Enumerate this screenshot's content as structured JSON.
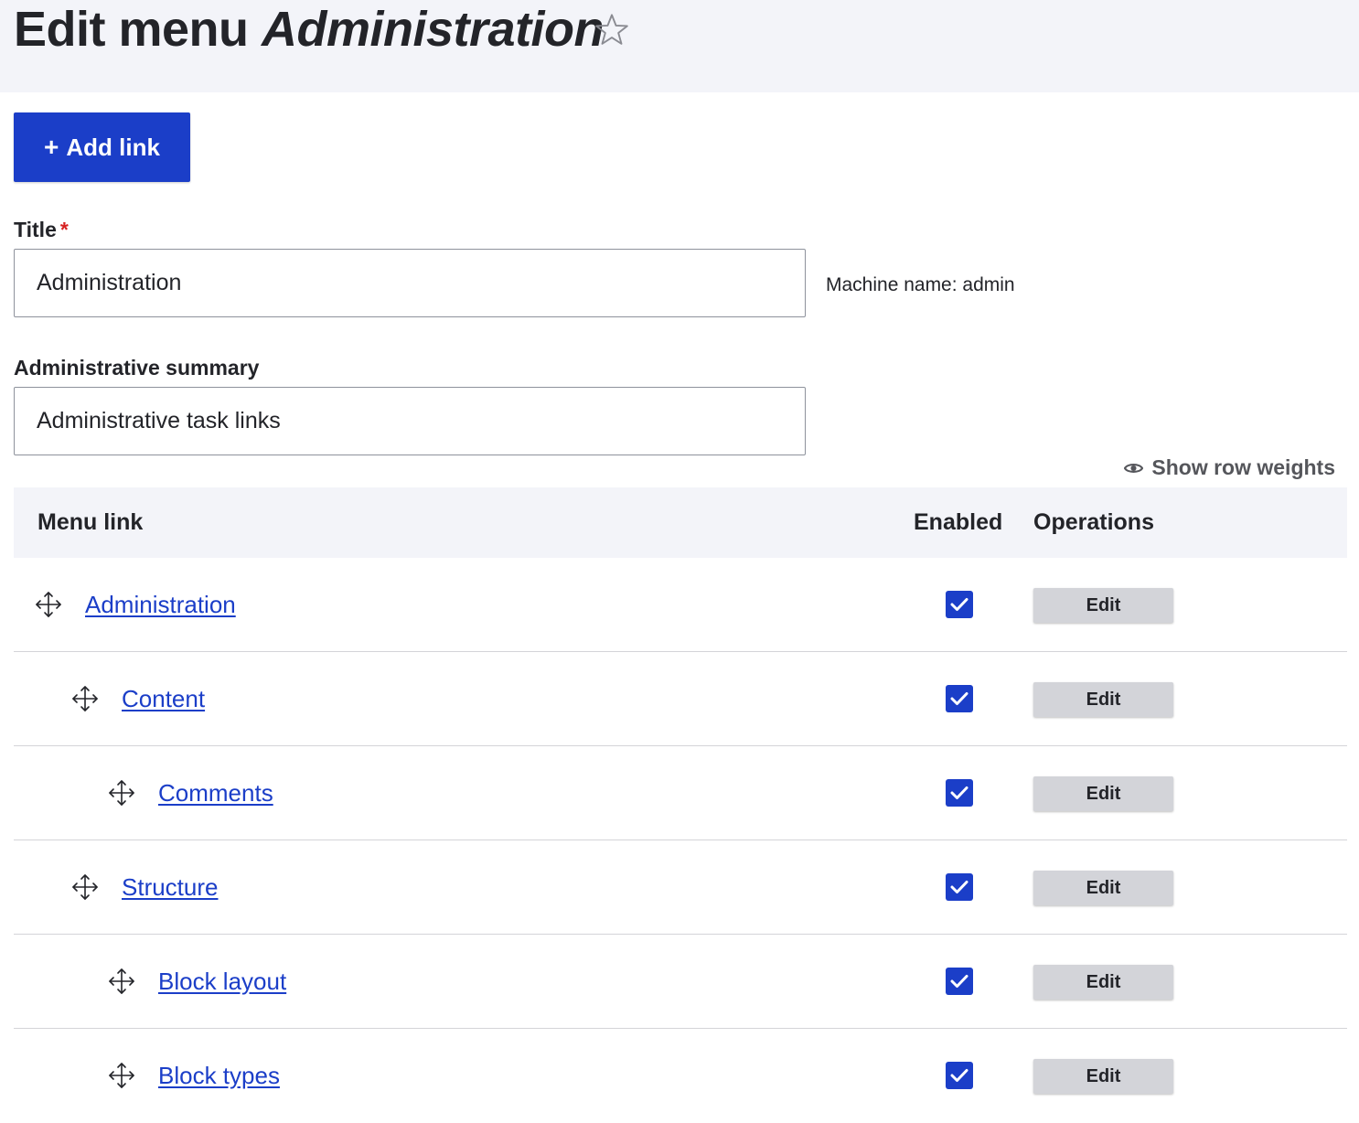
{
  "header": {
    "title_prefix": "Edit menu ",
    "title_emphasis": "Administration",
    "favorite_icon": "star-outline-icon"
  },
  "actions": {
    "add_link_icon": "+",
    "add_link_label": "Add link"
  },
  "form": {
    "title_label": "Title",
    "title_required_mark": "*",
    "title_value": "Administration",
    "machine_name": "Machine name: admin",
    "summary_label": "Administrative summary",
    "summary_value": "Administrative task links"
  },
  "table": {
    "show_weights_label": "Show row weights",
    "show_weights_icon": "eye-icon",
    "columns": {
      "menu_link": "Menu link",
      "enabled": "Enabled",
      "operations": "Operations"
    },
    "rows": [
      {
        "label": "Administration",
        "depth": 0,
        "enabled": true,
        "operation": "Edit"
      },
      {
        "label": "Content",
        "depth": 1,
        "enabled": true,
        "operation": "Edit"
      },
      {
        "label": "Comments",
        "depth": 2,
        "enabled": true,
        "operation": "Edit"
      },
      {
        "label": "Structure",
        "depth": 1,
        "enabled": true,
        "operation": "Edit"
      },
      {
        "label": "Block layout",
        "depth": 2,
        "enabled": true,
        "operation": "Edit"
      },
      {
        "label": "Block types",
        "depth": 2,
        "enabled": true,
        "operation": "Edit"
      }
    ]
  },
  "colors": {
    "primary": "#1b3ec8",
    "header_bg": "#f3f4f9",
    "required": "#d72222",
    "button_gray": "#d3d4d9"
  }
}
